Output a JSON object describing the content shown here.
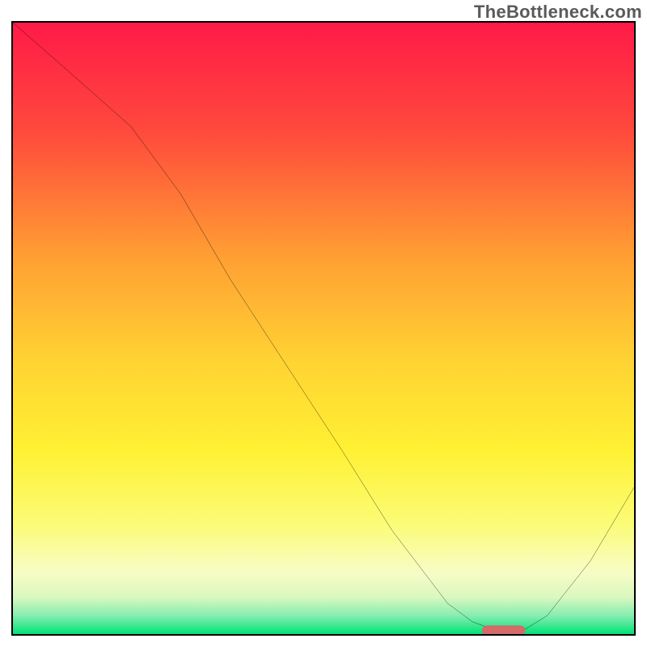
{
  "watermark": "TheBottleneck.com",
  "chart_data": {
    "type": "line",
    "title": "",
    "xlabel": "",
    "ylabel": "",
    "xlim": [
      0,
      100
    ],
    "ylim": [
      0,
      100
    ],
    "series": [
      {
        "name": "curve",
        "x": [
          0,
          9,
          19,
          27,
          35,
          44,
          53,
          61,
          70,
          74,
          78,
          82,
          86,
          93,
          100
        ],
        "y": [
          100,
          92,
          83,
          72,
          58,
          44,
          30,
          17,
          5,
          2,
          0.5,
          0.5,
          3,
          12,
          24
        ]
      }
    ],
    "marker": {
      "x": 79,
      "y": 0.6,
      "width": 7,
      "height": 1.6,
      "color": "#d46a6a"
    },
    "gradient_stops": [
      {
        "offset": 0,
        "color": "#ff1a48"
      },
      {
        "offset": 18,
        "color": "#ff4a3c"
      },
      {
        "offset": 38,
        "color": "#ff9e33"
      },
      {
        "offset": 55,
        "color": "#ffd233"
      },
      {
        "offset": 70,
        "color": "#fff133"
      },
      {
        "offset": 82,
        "color": "#fbfc77"
      },
      {
        "offset": 90,
        "color": "#f8fcc6"
      },
      {
        "offset": 94,
        "color": "#d9f8bf"
      },
      {
        "offset": 97,
        "color": "#86edb0"
      },
      {
        "offset": 100,
        "color": "#00e277"
      }
    ]
  }
}
